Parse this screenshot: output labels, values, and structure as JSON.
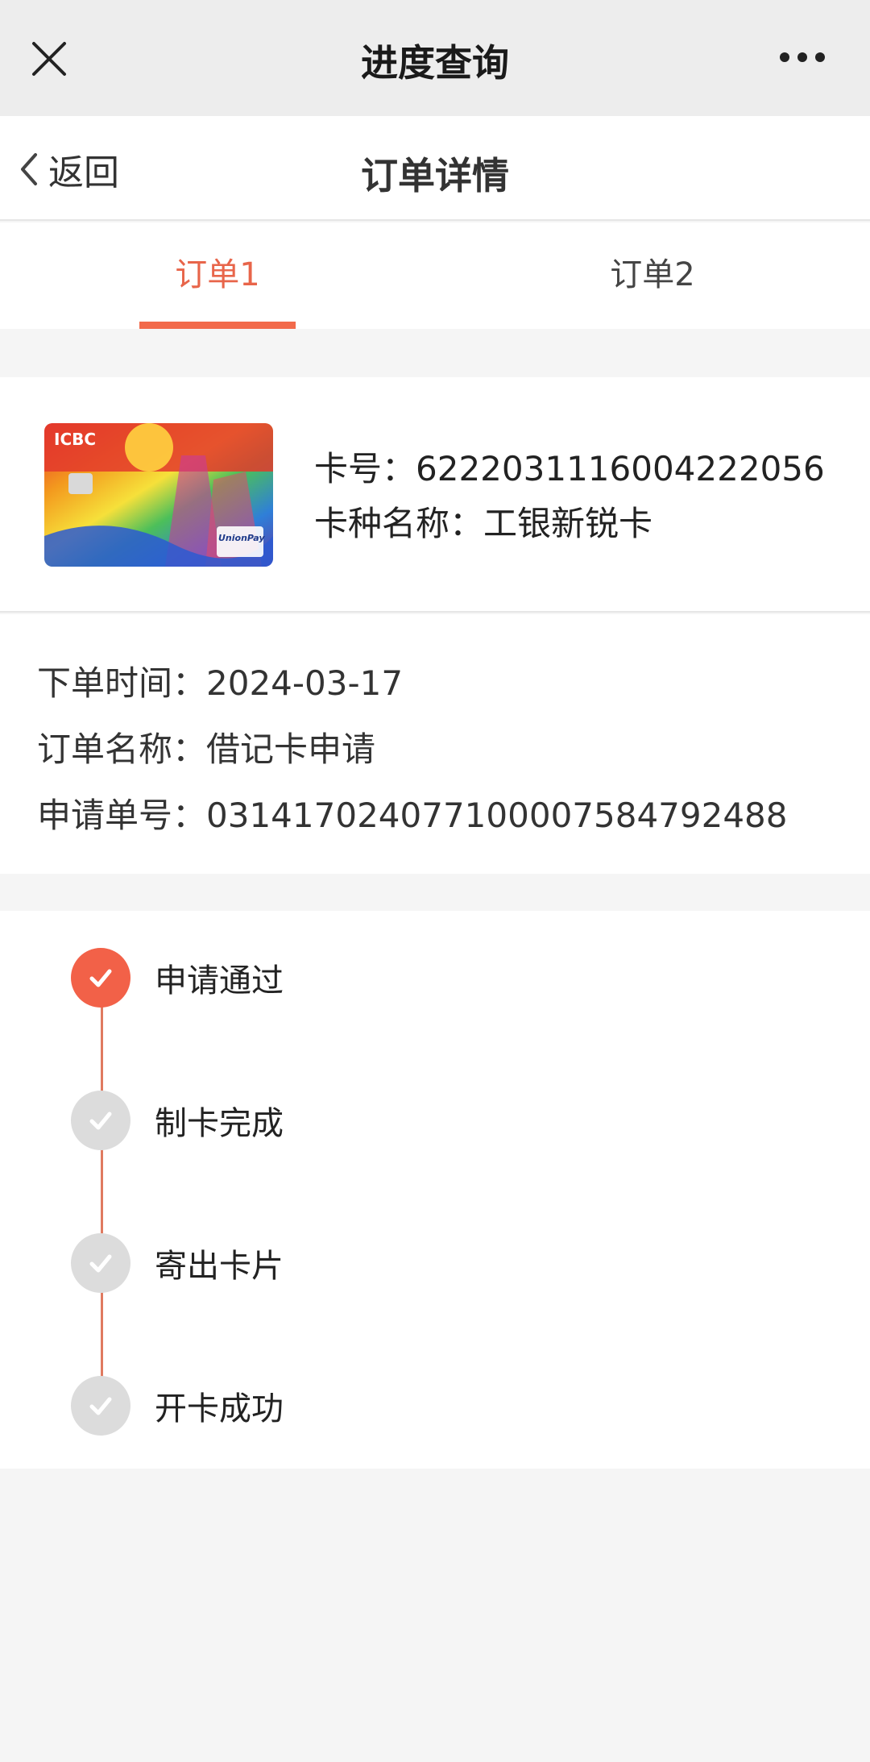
{
  "topbar": {
    "title": "进度查询",
    "close_icon": "close-icon",
    "more_icon": "more-dots-icon"
  },
  "subheader": {
    "back_label": "返回",
    "title": "订单详情"
  },
  "tabs": [
    {
      "label": "订单1",
      "active": true
    },
    {
      "label": "订单2",
      "active": false
    }
  ],
  "card": {
    "number_label": "卡号：",
    "number": "6222031116004222056",
    "type_label": "卡种名称：",
    "type": "工银新锐卡",
    "image_text": {
      "brand": "ICBC",
      "network": "UnionPay"
    }
  },
  "order": {
    "time_label": "下单时间：",
    "time": "2024-03-17",
    "name_label": "订单名称：",
    "name": "借记卡申请",
    "no_label": "申请单号：",
    "no": "03141702407710000758479248 8"
  },
  "steps": [
    {
      "label": "申请通过",
      "status": "done"
    },
    {
      "label": "制卡完成",
      "status": "pending"
    },
    {
      "label": "寄出卡片",
      "status": "pending"
    },
    {
      "label": "开卡成功",
      "status": "pending"
    }
  ],
  "colors": {
    "accent": "#f26a4b",
    "done": "#f26148",
    "pending": "#dcdcdc"
  }
}
